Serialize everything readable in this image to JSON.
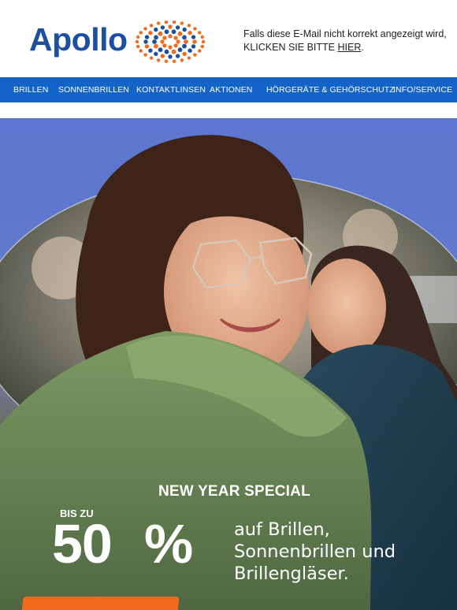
{
  "brand": {
    "name": "Apollo",
    "colors": {
      "primary_blue": "#1c4fa0",
      "nav_blue": "#1463c8",
      "accent_orange": "#f26a1b"
    }
  },
  "header": {
    "notice_line1": "Falls diese E-Mail nicht korrekt angezeigt wird,",
    "notice_line2_prefix": "KLICKEN SIE BITTE ",
    "notice_link": "HIER",
    "notice_suffix": "."
  },
  "nav": {
    "items": [
      {
        "label": "BRILLEN"
      },
      {
        "label": "SONNENBRILLEN"
      },
      {
        "label": "KONTAKTLINSEN"
      },
      {
        "label": "AKTIONEN"
      },
      {
        "label": "HÖRGERÄTE & GEHÖRSCHUTZ"
      },
      {
        "label": "INFO/SERVICE"
      }
    ]
  },
  "hero": {
    "headline": "NEW YEAR SPECIAL",
    "prefix": "BIS ZU",
    "number": "50",
    "percent": "%",
    "line1": "auf Brillen,",
    "line2": "Sonnenbrillen und",
    "line3": "Brillengläser."
  }
}
